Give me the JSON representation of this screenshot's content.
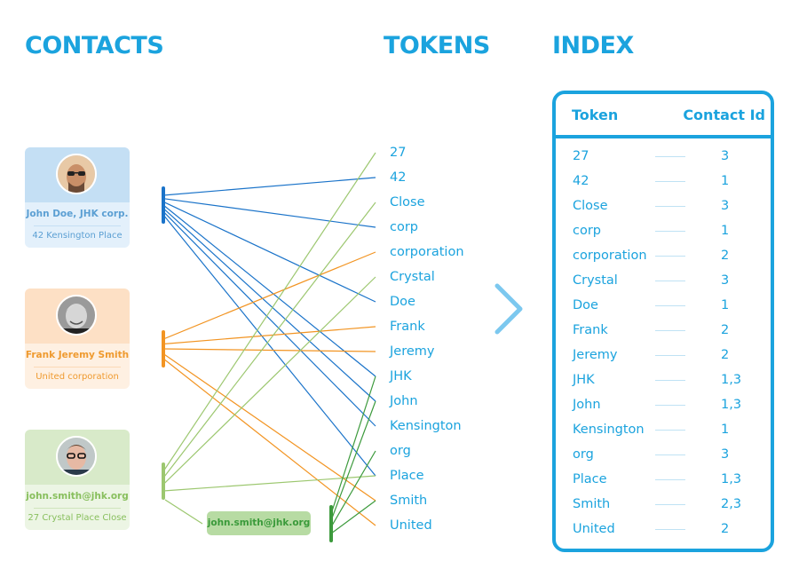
{
  "titles": {
    "contacts": "CONTACTS",
    "tokens": "TOKENS",
    "index": "INDEX"
  },
  "colors": {
    "accent": "#1ba3de",
    "contact1": "#1a73c9",
    "contact2": "#f29422",
    "contact3_address": "#9cc76f",
    "contact3_email": "#3c9a3c"
  },
  "contacts": [
    {
      "id": 1,
      "avatar": "avatar-man-beard-glasses",
      "line1": "John Doe, JHK corp.",
      "line2": "42 Kensington Place"
    },
    {
      "id": 2,
      "avatar": "avatar-older-man",
      "line1": "Frank Jeremy Smith",
      "line2": "United corporation"
    },
    {
      "id": 3,
      "avatar": "avatar-man-glasses",
      "line1": "john.smith@jhk.org",
      "line2": "27 Crystal Place Close"
    }
  ],
  "email_pill": "john.smith@jhk.org",
  "tokens": [
    "27",
    "42",
    "Close",
    "corp",
    "corporation",
    "Crystal",
    "Doe",
    "Frank",
    "Jeremy",
    "JHK",
    "John",
    "Kensington",
    "org",
    "Place",
    "Smith",
    "United"
  ],
  "links": [
    {
      "source": "contact1",
      "targets": [
        "42",
        "corp",
        "Doe",
        "JHK",
        "John",
        "Kensington",
        "Place"
      ]
    },
    {
      "source": "contact2",
      "targets": [
        "corporation",
        "Frank",
        "Jeremy",
        "Smith",
        "United"
      ]
    },
    {
      "source": "contact3_address",
      "targets": [
        "27",
        "Close",
        "Crystal",
        "Place"
      ]
    },
    {
      "source": "contact3_email",
      "targets": [
        "JHK",
        "John",
        "org",
        "Smith"
      ]
    }
  ],
  "arrow_icon": "chevron-right-icon",
  "index": {
    "header_token": "Token",
    "header_contact_id": "Contact Id",
    "rows": [
      {
        "token": "27",
        "ids": "3"
      },
      {
        "token": "42",
        "ids": "1"
      },
      {
        "token": "Close",
        "ids": "3"
      },
      {
        "token": "corp",
        "ids": "1"
      },
      {
        "token": "corporation",
        "ids": "2"
      },
      {
        "token": "Crystal",
        "ids": "3"
      },
      {
        "token": "Doe",
        "ids": "1"
      },
      {
        "token": "Frank",
        "ids": "2"
      },
      {
        "token": "Jeremy",
        "ids": "2"
      },
      {
        "token": "JHK",
        "ids": "1,3"
      },
      {
        "token": "John",
        "ids": "1,3"
      },
      {
        "token": "Kensington",
        "ids": "1"
      },
      {
        "token": "org",
        "ids": "3"
      },
      {
        "token": "Place",
        "ids": "1,3"
      },
      {
        "token": "Smith",
        "ids": "2,3"
      },
      {
        "token": "United",
        "ids": "2"
      }
    ]
  }
}
